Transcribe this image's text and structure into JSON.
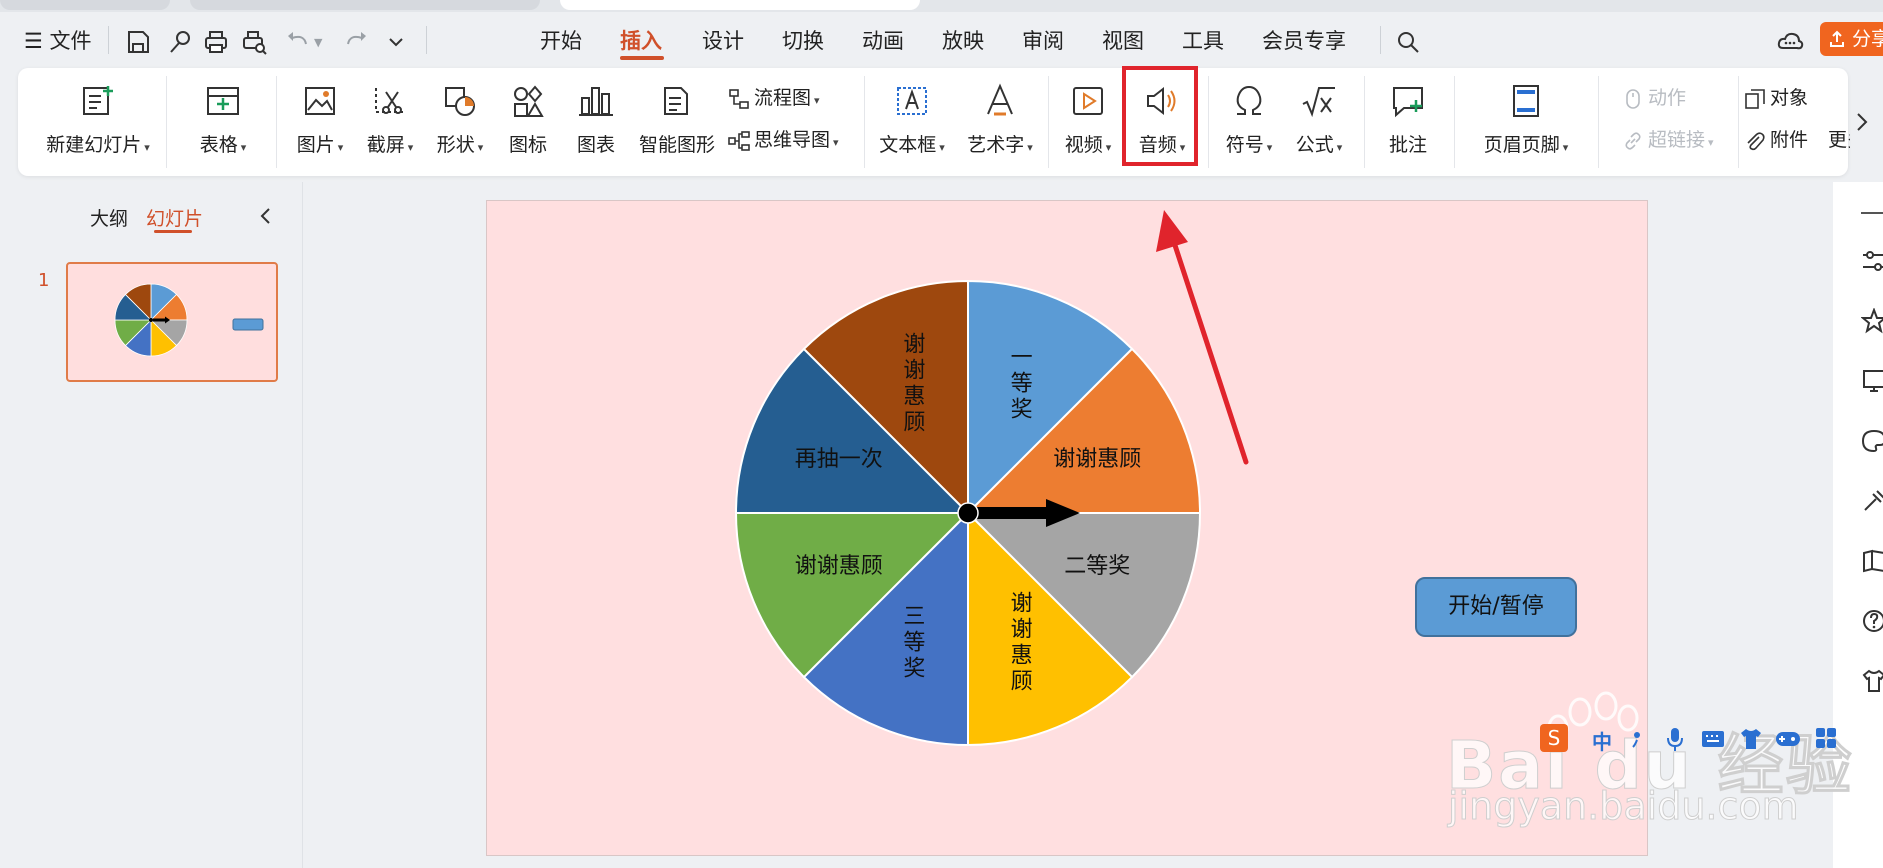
{
  "menu": {
    "hamburger": "☰",
    "file": "文件",
    "tabs": [
      "开始",
      "插入",
      "设计",
      "切换",
      "动画",
      "放映",
      "审阅",
      "视图",
      "工具",
      "会员专享"
    ],
    "active_tab": "插入",
    "share_label": "分享"
  },
  "ribbon": {
    "new_slide": "新建幻灯片",
    "table": "表格",
    "picture": "图片",
    "screenshot": "截屏",
    "shape": "形状",
    "icon": "图标",
    "chart": "图表",
    "smart_art": "智能图形",
    "flowchart": "流程图",
    "mindmap": "思维导图",
    "textbox": "文本框",
    "wordart": "艺术字",
    "video": "视频",
    "audio": "音频",
    "symbol": "符号",
    "formula": "公式",
    "comment": "批注",
    "header_footer": "页眉页脚",
    "action": "动作",
    "hyperlink": "超链接",
    "object": "对象",
    "attachment": "附件",
    "more": "更多"
  },
  "left_panel": {
    "outline_tab": "大纲",
    "slides_tab": "幻灯片",
    "active": "幻灯片",
    "slide_number": "1"
  },
  "slide": {
    "background": "#ffdfe0",
    "start_button": "开始/暂停",
    "wheel_segments": [
      {
        "label": "一等奖",
        "color": "#5b9bd5"
      },
      {
        "label": "谢谢惠顾",
        "color": "#ed7d31"
      },
      {
        "label": "二等奖",
        "color": "#a5a5a5"
      },
      {
        "label": "谢谢惠顾",
        "color": "#ffc000"
      },
      {
        "label": "三等奖",
        "color": "#4472c4"
      },
      {
        "label": "谢谢惠顾",
        "color": "#70ad47"
      },
      {
        "label": "再抽一次",
        "color": "#255e91"
      },
      {
        "label": "谢谢惠顾",
        "color": "#9e480e"
      }
    ]
  },
  "colors": {
    "accent": "#d0502a",
    "highlight": "#e0242c"
  },
  "watermark": {
    "brand": "Bai du 经验",
    "url": "jingyan.baidu.com"
  }
}
